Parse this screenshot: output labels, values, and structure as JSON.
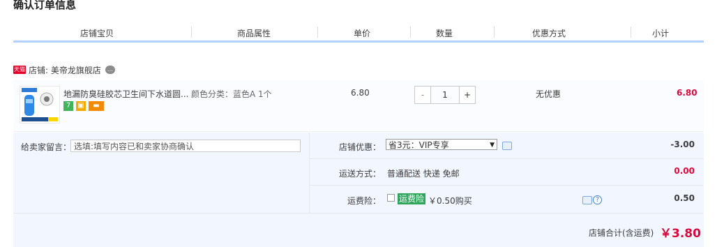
{
  "page_title": "确认订单信息",
  "columns": [
    "店铺宝贝",
    "商品属性",
    "单价",
    "数量",
    "优惠方式",
    "小计"
  ],
  "shop": {
    "badge": "天猫",
    "label": "店铺: 美帝龙旗舰店"
  },
  "item": {
    "title": "地漏防臭硅胶芯卫生间下水道圆...",
    "attr": "颜色分类：蓝色A 1个",
    "price": "6.80",
    "qty_minus": "-",
    "qty": "1",
    "qty_plus": "+",
    "promo": "无优惠",
    "subtotal": "6.80",
    "tag1": "7"
  },
  "memo": {
    "label": "给卖家留言：",
    "placeholder": "选填:填写内容已和卖家协商确认"
  },
  "discount": {
    "label": "店铺优惠：",
    "selected": "省3元：VIP专享",
    "amount": "-3.00"
  },
  "shipping": {
    "label": "运送方式：",
    "value": "普通配送 快递 免邮",
    "amount": "0.00"
  },
  "insurance": {
    "label": "运费险：",
    "tag": "运费险",
    "text": "￥0.50购买",
    "amount": "0.50"
  },
  "total": {
    "label": "店铺合计(含运费)",
    "value": "￥3.80"
  },
  "colors": {
    "accent_red": "#d9093c",
    "header_line": "#b2d1ff",
    "panel_bg": "#f1f6ff",
    "tmall_red": "#e4002b",
    "insurance_green": "#2fa55c"
  }
}
